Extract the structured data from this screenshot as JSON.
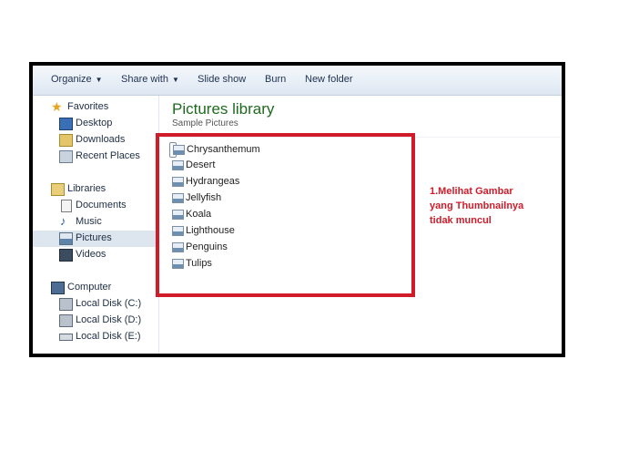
{
  "toolbar": {
    "organize": "Organize",
    "share_with": "Share with",
    "slide_show": "Slide show",
    "burn": "Burn",
    "new_folder": "New folder"
  },
  "nav": {
    "favorites": {
      "label": "Favorites",
      "items": [
        "Desktop",
        "Downloads",
        "Recent Places"
      ]
    },
    "libraries": {
      "label": "Libraries",
      "items": [
        "Documents",
        "Music",
        "Pictures",
        "Videos"
      ]
    },
    "computer": {
      "label": "Computer",
      "items": [
        "Local Disk (C:)",
        "Local Disk (D:)",
        "Local Disk (E:)"
      ]
    },
    "selected": "Pictures"
  },
  "content": {
    "title": "Pictures library",
    "subtitle": "Sample Pictures",
    "files": [
      "Chrysanthemum",
      "Desert",
      "Hydrangeas",
      "Jellyfish",
      "Koala",
      "Lighthouse",
      "Penguins",
      "Tulips"
    ]
  },
  "annotation": {
    "lines": [
      "1.Melihat Gambar",
      "yang Thumbnailnya",
      "tidak muncul"
    ]
  },
  "colors": {
    "annotation_red": "#d01c2a",
    "title_green": "#1e6a1e",
    "toolbar_text": "#1e3050"
  }
}
